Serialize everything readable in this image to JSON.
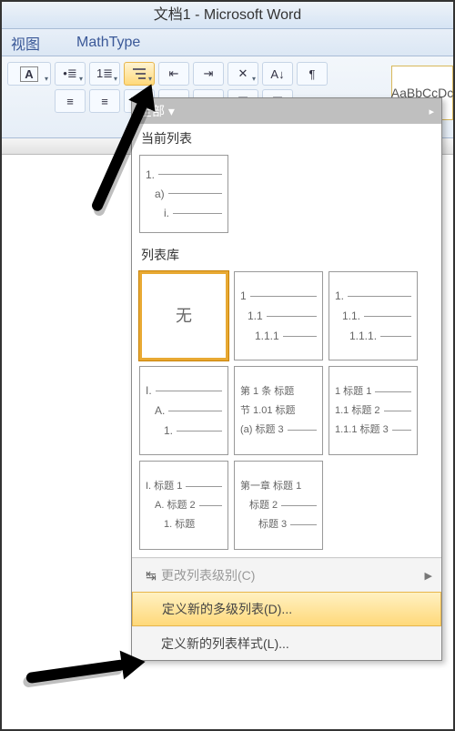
{
  "window": {
    "title": "文档1 - Microsoft Word"
  },
  "tabs": {
    "view": "视图",
    "mathtype": "MathType"
  },
  "ribbon": {
    "font_box": "A",
    "style_preview": "AaBbCcDc"
  },
  "dropdown": {
    "header_label": "全部",
    "current_list_label": "当前列表",
    "current_preview": {
      "l1": "1.",
      "l2": "a)",
      "l3": "i."
    },
    "library_label": "列表库",
    "none_label": "无",
    "lib": {
      "b": {
        "l1": "1",
        "l2": "1.1",
        "l3": "1.1.1"
      },
      "c": {
        "l1": "1.",
        "l2": "1.1.",
        "l3": "1.1.1."
      },
      "d": {
        "l1": "I.",
        "l2": "A.",
        "l3": "1."
      },
      "e": {
        "l1": "第 1 条 标题",
        "l2": "节 1.01 标题",
        "l3": "(a) 标题 3"
      },
      "f": {
        "l1": "1 标题 1",
        "l2": "1.1 标题 2",
        "l3": "1.1.1 标题 3"
      },
      "g": {
        "l1": "I. 标题 1",
        "l2": "A. 标题 2",
        "l3": "1. 标题"
      },
      "h": {
        "l1": "第一章 标题 1",
        "l2": "标题 2",
        "l3": "标题 3"
      }
    },
    "menu": {
      "change_level": "更改列表级别(C)",
      "define_new_list": "定义新的多级列表(D)...",
      "define_new_style": "定义新的列表样式(L)..."
    }
  }
}
